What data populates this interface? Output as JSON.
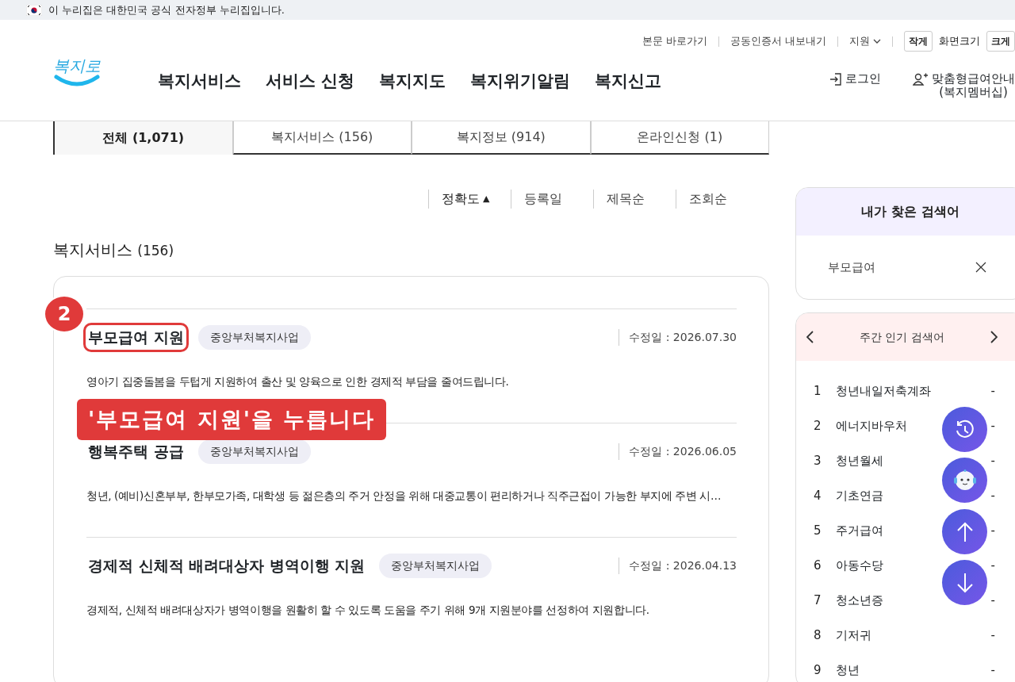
{
  "gov_banner": {
    "text": "이 누리집은 대한민국 공식 전자정부 누리집입니다."
  },
  "utility_links": [
    {
      "label": "본문 바로가기",
      "kind": "link"
    },
    {
      "label": "공동인증서 내보내기",
      "kind": "link"
    },
    {
      "label": "지원",
      "kind": "dropdown"
    },
    {
      "label": "작게",
      "kind": "button"
    },
    {
      "label": "화면크기",
      "kind": "label"
    },
    {
      "label": "크게",
      "kind": "button"
    }
  ],
  "logo": {
    "text": "복지로"
  },
  "main_nav": [
    "복지서비스",
    "서비스 신청",
    "복지지도",
    "복지위기알림",
    "복지신고"
  ],
  "account_links": [
    {
      "kind": "login",
      "lines": [
        "로그인"
      ]
    },
    {
      "kind": "membership",
      "lines": [
        "맞춤형급여안내",
        "(복지멤버십)"
      ]
    }
  ],
  "result_tabs": [
    {
      "label": "전체  (1,071)",
      "selected": true
    },
    {
      "label": "복지서비스 (156)",
      "selected": false
    },
    {
      "label": "복지정보 (914)",
      "selected": false
    },
    {
      "label": "온라인신청 (1)",
      "selected": false
    }
  ],
  "sort_options": [
    {
      "label": "정확도",
      "selected": true,
      "arrow": "▲"
    },
    {
      "label": "등록일",
      "selected": false
    },
    {
      "label": "제목순",
      "selected": false
    },
    {
      "label": "조회순",
      "selected": false
    }
  ],
  "section": {
    "title": "복지서비스",
    "count": "(156)"
  },
  "results": [
    {
      "title": "부모급여 지원",
      "tag": "중앙부처복지사업",
      "date_label": "수정일 :",
      "date": "2026.07.30",
      "summary": "영아기 집중돌봄을 두텁게 지원하여 출산 및 양육으로 인한 경제적 부담을 줄여드립니다.",
      "highlighted": true
    },
    {
      "title": "행복주택 공급",
      "tag": "중앙부처복지사업",
      "date_label": "수정일 :",
      "date": "2026.06.05",
      "summary": "청년, (예비)신혼부부, 한부모가족, 대학생 등 젊은층의 주거 안정을 위해 대중교통이 편리하거나 직주근접이 가능한 부지에 주변 시…",
      "highlighted": false
    },
    {
      "title": "경제적 신체적 배려대상자 병역이행 지원",
      "tag": "중앙부처복지사업",
      "date_label": "수정일 :",
      "date": "2026.04.13",
      "summary": "경제적, 신체적 배려대상자가 병역이행을 원활히 할 수 있도록 도움을 주기 위해 9개 지원분야를 선정하여 지원합니다.",
      "highlighted": false
    }
  ],
  "recent_searches": {
    "title": "내가 찾은 검색어",
    "items": [
      {
        "term": "부모급여"
      }
    ]
  },
  "popular_searches": {
    "title": "주간 인기 검색어",
    "items": [
      {
        "rank": "1",
        "term": "청년내일저축계좌",
        "change": "-"
      },
      {
        "rank": "2",
        "term": "에너지바우처",
        "change": "-"
      },
      {
        "rank": "3",
        "term": "청년월세",
        "change": "-"
      },
      {
        "rank": "4",
        "term": "기초연금",
        "change": "-"
      },
      {
        "rank": "5",
        "term": "주거급여",
        "change": "-"
      },
      {
        "rank": "6",
        "term": "아동수당",
        "change": "-"
      },
      {
        "rank": "7",
        "term": "청소년증",
        "change": "-"
      },
      {
        "rank": "8",
        "term": "기저귀",
        "change": "-"
      },
      {
        "rank": "9",
        "term": "청년",
        "change": "-"
      }
    ]
  },
  "annotation": {
    "step": "2",
    "caption": "'부모급여 지원'을 누릅니다"
  },
  "floating_buttons": [
    {
      "kind": "history"
    },
    {
      "kind": "chatbot"
    },
    {
      "kind": "scroll_up"
    },
    {
      "kind": "scroll_down"
    }
  ]
}
